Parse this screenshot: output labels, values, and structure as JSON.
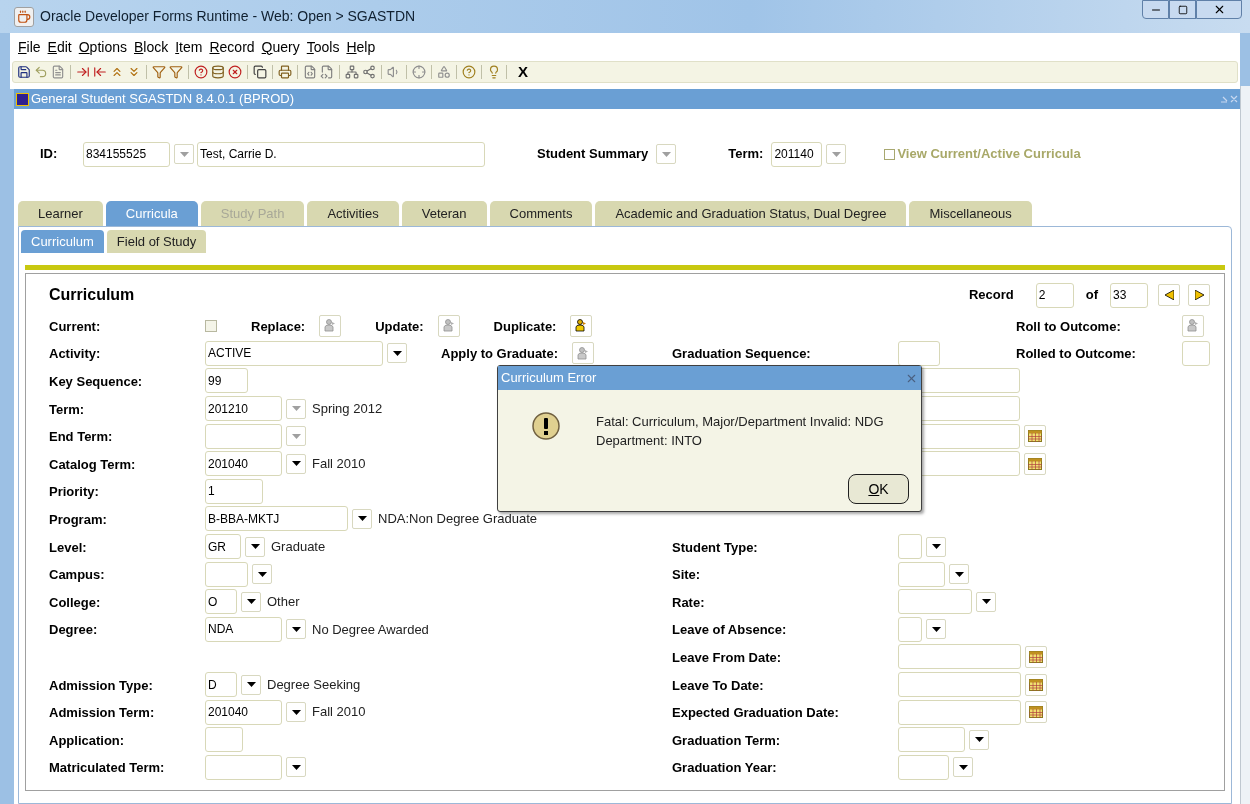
{
  "window": {
    "title": "Oracle Developer Forms Runtime - Web:  Open > SGASTDN"
  },
  "menu": [
    {
      "label": "File"
    },
    {
      "label": "Edit"
    },
    {
      "label": "Options"
    },
    {
      "label": "Block"
    },
    {
      "label": "Item"
    },
    {
      "label": "Record"
    },
    {
      "label": "Query"
    },
    {
      "label": "Tools"
    },
    {
      "label": "Help"
    }
  ],
  "toolbar": {
    "exit_label": "X"
  },
  "form_window": {
    "title": "General Student  SGASTDN  8.4.0.1  (BPROD)"
  },
  "header": {
    "id": {
      "label": "ID:",
      "value": "834155525",
      "disabled": true
    },
    "name_value": "Test, Carrie D.",
    "summary": {
      "label": "Student Summary",
      "disabled": true
    },
    "term": {
      "label": "Term:",
      "value": "201140",
      "disabled": true
    },
    "view_current": {
      "label": "View Current/Active Curricula",
      "checked": false
    }
  },
  "tabs": [
    {
      "label": "Learner",
      "selected": false,
      "disabled": false
    },
    {
      "label": "Curricula",
      "selected": true,
      "disabled": false
    },
    {
      "label": "Study Path",
      "selected": false,
      "disabled": true
    },
    {
      "label": "Activities",
      "selected": false,
      "disabled": false
    },
    {
      "label": "Veteran",
      "selected": false,
      "disabled": false
    },
    {
      "label": "Comments",
      "selected": false,
      "disabled": false
    },
    {
      "label": "Academic and Graduation Status, Dual Degree",
      "selected": false,
      "disabled": false
    },
    {
      "label": "Miscellaneous",
      "selected": false,
      "disabled": false
    }
  ],
  "subtabs": [
    {
      "label": "Curriculum",
      "selected": true
    },
    {
      "label": "Field of Study",
      "selected": false
    }
  ],
  "curriculum": {
    "title": "Curriculum",
    "record": {
      "label": "Record",
      "current": "2",
      "of_label": "of",
      "total": "33"
    },
    "rows": [
      {
        "left": [
          {
            "label": "Current:",
            "kind": "checkbox",
            "checked": false
          },
          {
            "label": "Replace:",
            "kind": "button",
            "disabled": true
          },
          {
            "label": "Update:",
            "kind": "button",
            "disabled": true
          },
          {
            "label": "Duplicate:",
            "kind": "button",
            "disabled": false
          }
        ],
        "right": {
          "label": "Roll to Outcome:",
          "kind": "button",
          "disabled": true
        }
      },
      {
        "left": [
          {
            "label": "Activity:",
            "kind": "select",
            "value": "ACTIVE",
            "disabled": false
          },
          {
            "label": "Apply to Graduate:",
            "kind": "button",
            "disabled": true
          }
        ],
        "middle": {
          "label": "Graduation Sequence:",
          "kind": "text"
        },
        "right": {
          "label": "Rolled to Outcome:",
          "kind": "text"
        }
      },
      {
        "left": [
          {
            "label": "Key Sequence:",
            "kind": "text",
            "value": "99"
          }
        ],
        "middle": {
          "kind": "text"
        }
      },
      {
        "left": [
          {
            "label": "Term:",
            "kind": "select",
            "value": "201210",
            "description": "Spring 2012",
            "disabled": true
          }
        ],
        "middle": {
          "kind": "text"
        }
      },
      {
        "left": [
          {
            "label": "End Term:",
            "kind": "select",
            "disabled": true
          }
        ],
        "middle": {
          "kind": "date"
        }
      },
      {
        "left": [
          {
            "label": "Catalog Term:",
            "kind": "select",
            "value": "201040",
            "description": "Fall 2010",
            "disabled": false
          }
        ],
        "middle": {
          "kind": "date"
        }
      },
      {
        "left": [
          {
            "label": "Priority:",
            "kind": "text",
            "value": "1"
          }
        ]
      },
      {
        "left": [
          {
            "label": "Program:",
            "kind": "select",
            "value": "B-BBA-MKTJ",
            "description": "NDA:Non Degree Graduate",
            "disabled": false
          }
        ]
      },
      {
        "left": [
          {
            "label": "Level:",
            "kind": "select",
            "value": "GR",
            "description": "Graduate",
            "disabled": false
          }
        ],
        "middle": {
          "label": "Student Type:",
          "kind": "select",
          "disabled": false
        }
      },
      {
        "left": [
          {
            "label": "Campus:",
            "kind": "select",
            "disabled": false
          }
        ],
        "middle": {
          "label": "Site:",
          "kind": "select",
          "disabled": false
        }
      },
      {
        "left": [
          {
            "label": "College:",
            "kind": "select",
            "value": "O",
            "description": "Other",
            "disabled": false
          }
        ],
        "middle": {
          "label": "Rate:",
          "kind": "select",
          "disabled": false
        }
      },
      {
        "left": [
          {
            "label": "Degree:",
            "kind": "select",
            "value": "NDA",
            "description": "No Degree Awarded",
            "disabled": false
          }
        ],
        "middle": {
          "label": "Leave of Absence:",
          "kind": "select",
          "disabled": false
        }
      },
      {
        "left": [],
        "middle": {
          "label": "Leave From Date:",
          "kind": "date"
        }
      },
      {
        "left": [
          {
            "label": "Admission Type:",
            "kind": "select",
            "value": "D",
            "description": "Degree Seeking",
            "disabled": false
          }
        ],
        "middle": {
          "label": "Leave To Date:",
          "kind": "date"
        }
      },
      {
        "left": [
          {
            "label": "Admission Term:",
            "kind": "select",
            "value": "201040",
            "description": "Fall 2010",
            "disabled": false
          }
        ],
        "middle": {
          "label": "Expected Graduation Date:",
          "kind": "date"
        }
      },
      {
        "left": [
          {
            "label": "Application:",
            "kind": "text"
          }
        ],
        "middle": {
          "label": "Graduation Term:",
          "kind": "select",
          "disabled": false
        }
      },
      {
        "left": [
          {
            "label": "Matriculated Term:",
            "kind": "select",
            "disabled": false
          }
        ],
        "middle": {
          "label": "Graduation Year:",
          "kind": "select",
          "disabled": false
        }
      }
    ]
  },
  "dialog": {
    "title": "Curriculum Error",
    "message_lines": [
      "Fatal: Curriculum, Major/Department Invalid: NDG",
      "Department: INTO"
    ],
    "ok_label": "OK"
  }
}
